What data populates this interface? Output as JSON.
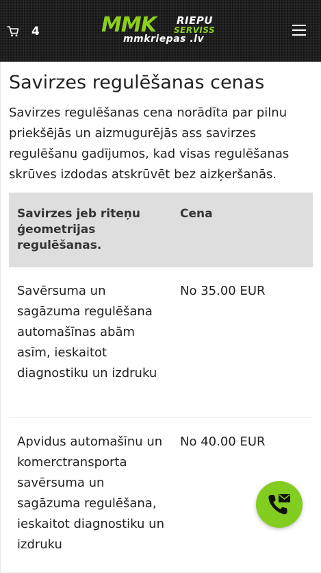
{
  "header": {
    "cart_count": "4",
    "logo": {
      "brand": "MMK",
      "word1": "RIEPU",
      "word2": "SERVISS",
      "domain": "mmkriepas .lv"
    },
    "icons": [
      "cart-icon",
      "menu-icon"
    ],
    "colors": {
      "background": "#1e1e1e",
      "accent": "#83cc20"
    }
  },
  "main": {
    "title": "Savirzes regulēšanas cenas",
    "intro": "Savirzes regulēšanas cena norādīta par pilnu priekšējās un aizmugurējās ass savirzes regulēšanu gadījumos, kad visas regulēšanas skrūves izdodas atskrūvēt bez aizķeršanās.",
    "table": {
      "headers": [
        "Savirzes jeb riteņu ģeometrijas regulēšanas.",
        "Cena"
      ],
      "rows": [
        [
          "Savērsuma un sagāzuma regulēšana automašīnas abām asīm, ieskaitot diagnostiku un izdruku",
          "No 35.00 EUR"
        ],
        [
          "Apvidus automašīnu un komerctransporta savērsuma un sagāzuma regulēšana, ieskaitot diagnostiku un izdruku",
          "No 40.00 EUR"
        ]
      ]
    }
  },
  "fab": {
    "icon": "phone-mail-icon",
    "color": "#83cc20"
  }
}
